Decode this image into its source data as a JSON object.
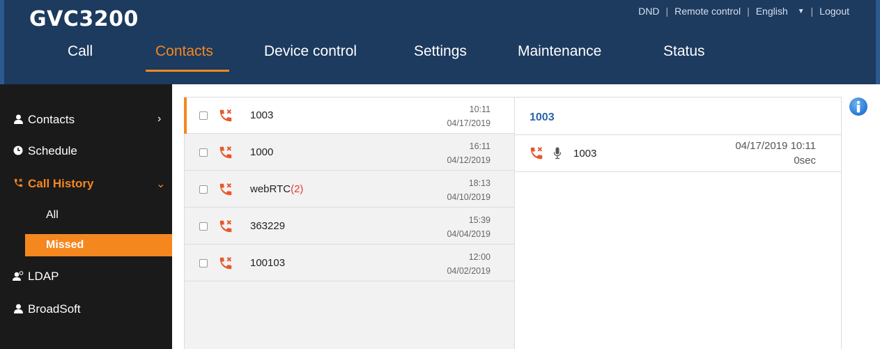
{
  "header": {
    "logo": "GVC3200",
    "toplinks": {
      "dnd": "DND",
      "remote": "Remote control",
      "language": "English",
      "logout": "Logout",
      "sep": "|"
    },
    "nav": [
      {
        "label": "Call"
      },
      {
        "label": "Contacts",
        "active": true
      },
      {
        "label": "Device control"
      },
      {
        "label": "Settings"
      },
      {
        "label": "Maintenance"
      },
      {
        "label": "Status"
      }
    ]
  },
  "sidebar": {
    "items": [
      {
        "label": "Contacts",
        "icon": "person-icon"
      },
      {
        "label": "Schedule",
        "icon": "clock-icon"
      },
      {
        "label": "Call History",
        "icon": "call-history-icon",
        "active": true
      },
      {
        "label": "LDAP",
        "icon": "ldap-icon"
      },
      {
        "label": "BroadSoft",
        "icon": "person-icon"
      }
    ],
    "sub": {
      "all": "All",
      "missed": "Missed"
    }
  },
  "calls": [
    {
      "name": "1003",
      "count": "",
      "time": "10:11",
      "date": "04/17/2019",
      "selected": true
    },
    {
      "name": "1000",
      "count": "",
      "time": "16:11",
      "date": "04/12/2019"
    },
    {
      "name": "webRTC",
      "count": "(2)",
      "time": "18:13",
      "date": "04/10/2019"
    },
    {
      "name": "363229",
      "count": "",
      "time": "15:39",
      "date": "04/04/2019"
    },
    {
      "name": "100103",
      "count": "",
      "time": "12:00",
      "date": "04/02/2019"
    }
  ],
  "detail": {
    "title": "1003",
    "entry": {
      "name": "1003",
      "datetime": "04/17/2019 10:11",
      "duration": "0sec"
    }
  },
  "colors": {
    "accent": "#f5871f",
    "header": "#1d3a5f",
    "sidebar": "#1a1a1a",
    "missed": "#e8572e",
    "link": "#2a66a8"
  }
}
